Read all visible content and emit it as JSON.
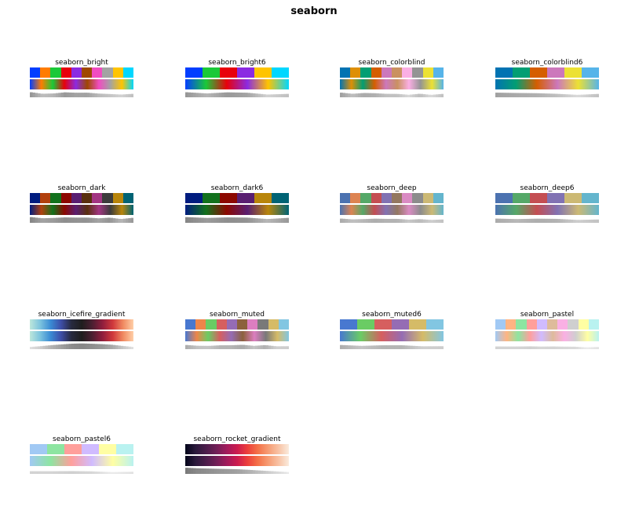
{
  "title": "seaborn",
  "palettes": [
    {
      "name": "seaborn_bright",
      "kind": "discrete",
      "colors": [
        "#023eff",
        "#ff7c00",
        "#1ac938",
        "#e8000b",
        "#8b2be2",
        "#9f4800",
        "#f14cc1",
        "#a3a3a3",
        "#ffc400",
        "#00d7ff"
      ]
    },
    {
      "name": "seaborn_bright6",
      "kind": "discrete",
      "colors": [
        "#023eff",
        "#1ac938",
        "#e8000b",
        "#8b2be2",
        "#ffc400",
        "#00d7ff"
      ]
    },
    {
      "name": "seaborn_colorblind",
      "kind": "discrete",
      "colors": [
        "#0173b2",
        "#de8f05",
        "#029e73",
        "#d55e00",
        "#cc78bc",
        "#ca9161",
        "#fbafe4",
        "#949494",
        "#ece133",
        "#56b4e9"
      ]
    },
    {
      "name": "seaborn_colorblind6",
      "kind": "discrete",
      "colors": [
        "#0173b2",
        "#029e73",
        "#d55e00",
        "#cc78bc",
        "#ece133",
        "#56b4e9"
      ]
    },
    {
      "name": "seaborn_dark",
      "kind": "discrete",
      "colors": [
        "#001c7f",
        "#b1400d",
        "#12711c",
        "#8c0800",
        "#591e71",
        "#592f0d",
        "#a23582",
        "#3c3c3c",
        "#b8850a",
        "#006374"
      ]
    },
    {
      "name": "seaborn_dark6",
      "kind": "discrete",
      "colors": [
        "#001c7f",
        "#12711c",
        "#8c0800",
        "#591e71",
        "#b8850a",
        "#006374"
      ]
    },
    {
      "name": "seaborn_deep",
      "kind": "discrete",
      "colors": [
        "#4c72b0",
        "#dd8452",
        "#55a868",
        "#c44e52",
        "#8172b3",
        "#937860",
        "#da8bc3",
        "#8c8c8c",
        "#ccb974",
        "#64b5cd"
      ]
    },
    {
      "name": "seaborn_deep6",
      "kind": "discrete",
      "colors": [
        "#4c72b0",
        "#55a868",
        "#c44e52",
        "#8172b3",
        "#ccb974",
        "#64b5cd"
      ]
    },
    {
      "name": "seaborn_icefire_gradient",
      "kind": "gradient",
      "colors": [
        "#bde7db",
        "#7cc3de",
        "#3a8bd4",
        "#3e4ea8",
        "#272a3f",
        "#1f1e1e",
        "#4a1f31",
        "#8f1d3d",
        "#d0383c",
        "#f08a61",
        "#ffcfa8"
      ]
    },
    {
      "name": "seaborn_muted",
      "kind": "discrete",
      "colors": [
        "#4878d0",
        "#ee854a",
        "#6acc64",
        "#d65f5f",
        "#956cb4",
        "#8c613c",
        "#dc7ec0",
        "#797979",
        "#d5bb67",
        "#82c6e2"
      ]
    },
    {
      "name": "seaborn_muted6",
      "kind": "discrete",
      "colors": [
        "#4878d0",
        "#6acc64",
        "#d65f5f",
        "#956cb4",
        "#d5bb67",
        "#82c6e2"
      ]
    },
    {
      "name": "seaborn_pastel",
      "kind": "discrete",
      "colors": [
        "#a1c9f4",
        "#ffb482",
        "#8de5a1",
        "#ff9f9b",
        "#d0bbff",
        "#debb9b",
        "#fab0e4",
        "#cfcfcf",
        "#fffea3",
        "#b9f2f0"
      ]
    },
    {
      "name": "seaborn_pastel6",
      "kind": "discrete",
      "colors": [
        "#a1c9f4",
        "#8de5a1",
        "#ff9f9b",
        "#d0bbff",
        "#fffea3",
        "#b9f2f0"
      ]
    },
    {
      "name": "seaborn_rocket_gradient",
      "kind": "gradient",
      "colors": [
        "#03051a",
        "#2b1a3c",
        "#4c1d4b",
        "#711f57",
        "#a11a5b",
        "#cb1b4f",
        "#ec3f3b",
        "#f47148",
        "#f69c73",
        "#f8c2a4",
        "#faebdd"
      ]
    }
  ]
}
